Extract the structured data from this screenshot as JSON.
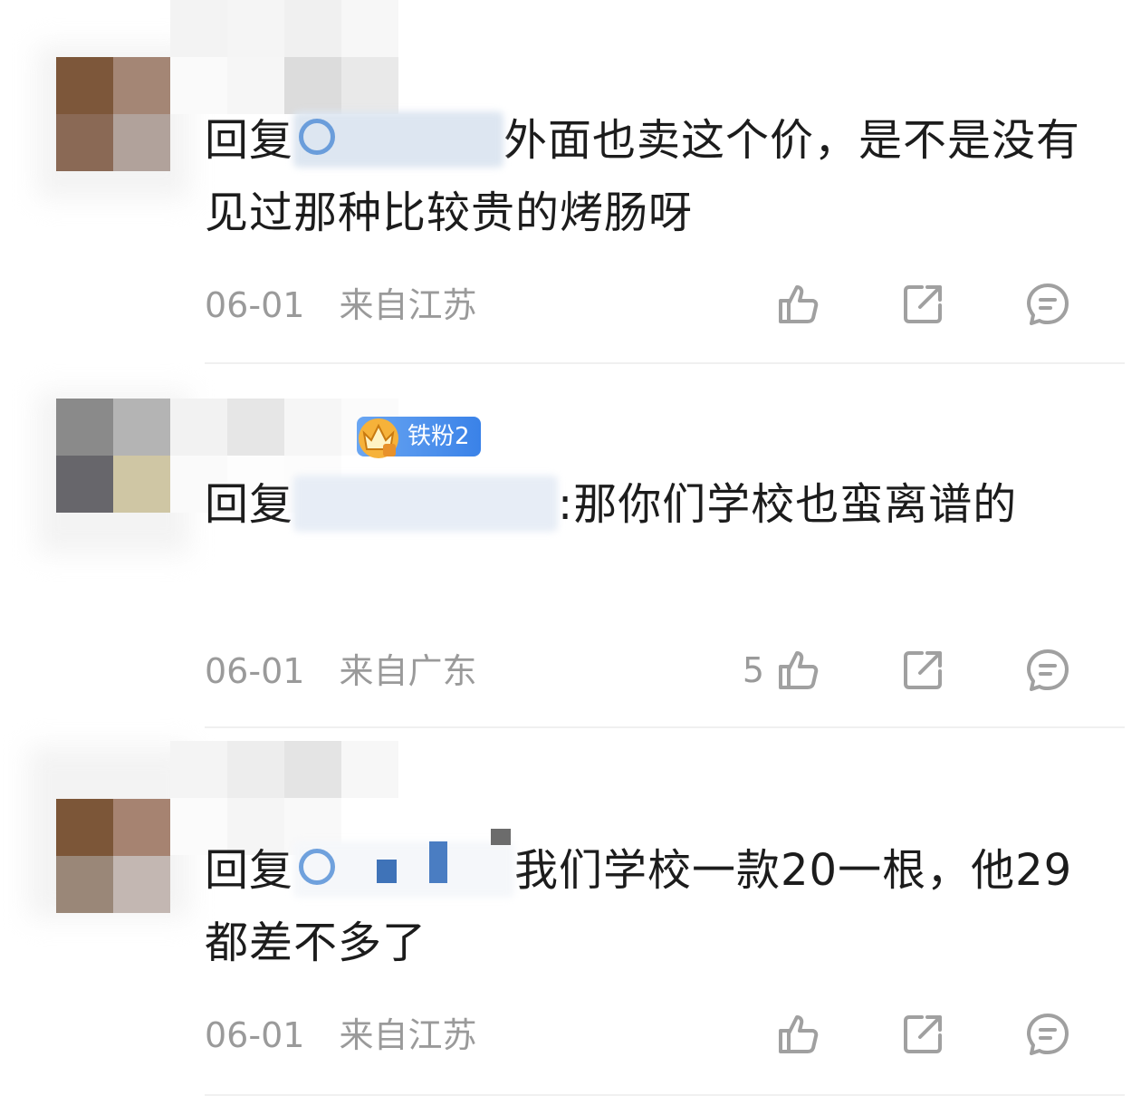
{
  "comments": [
    {
      "reply_prefix": "回复",
      "text_after_mention": "外面也卖这个价，是不是没有见过那种比较贵的烤肠呀",
      "date": "06-01",
      "location": "来自江苏",
      "like_count": "",
      "has_badge": false
    },
    {
      "reply_prefix": "回复",
      "text_after_mention": ":那你们学校也蛮离谱的",
      "date": "06-01",
      "location": "来自广东",
      "like_count": "5",
      "has_badge": true,
      "badge_label": "铁粉2"
    },
    {
      "reply_prefix": "回复",
      "text_after_mention": "我们学校一款20一根，他29都差不多了",
      "date": "06-01",
      "location": "来自江苏",
      "like_count": "",
      "has_badge": false
    }
  ],
  "icons": {
    "like": "thumbs-up-icon",
    "share": "share-icon",
    "reply": "comment-icon"
  },
  "colors": {
    "text": "#1c1c1c",
    "meta": "#9a9a9a",
    "icon": "#a0a0a0",
    "badge": "#3a82e8",
    "mention_blur": "#dde6f1"
  }
}
